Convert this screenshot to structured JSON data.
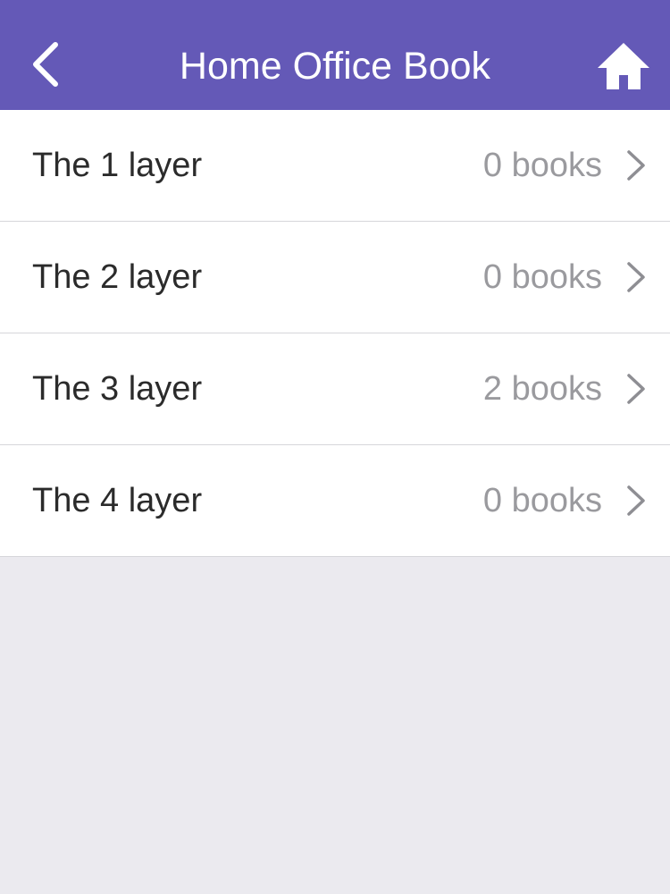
{
  "header": {
    "title": "Home Office Book",
    "back_icon": "chevron-left-icon",
    "home_icon": "home-icon",
    "background": "#6459b7"
  },
  "layers": [
    {
      "label": "The 1 layer",
      "count": "0 books"
    },
    {
      "label": "The 2 layer",
      "count": "0 books"
    },
    {
      "label": "The 3 layer",
      "count": "2 books"
    },
    {
      "label": "The 4 layer",
      "count": "0 books"
    }
  ],
  "row_icon": "chevron-right-icon"
}
